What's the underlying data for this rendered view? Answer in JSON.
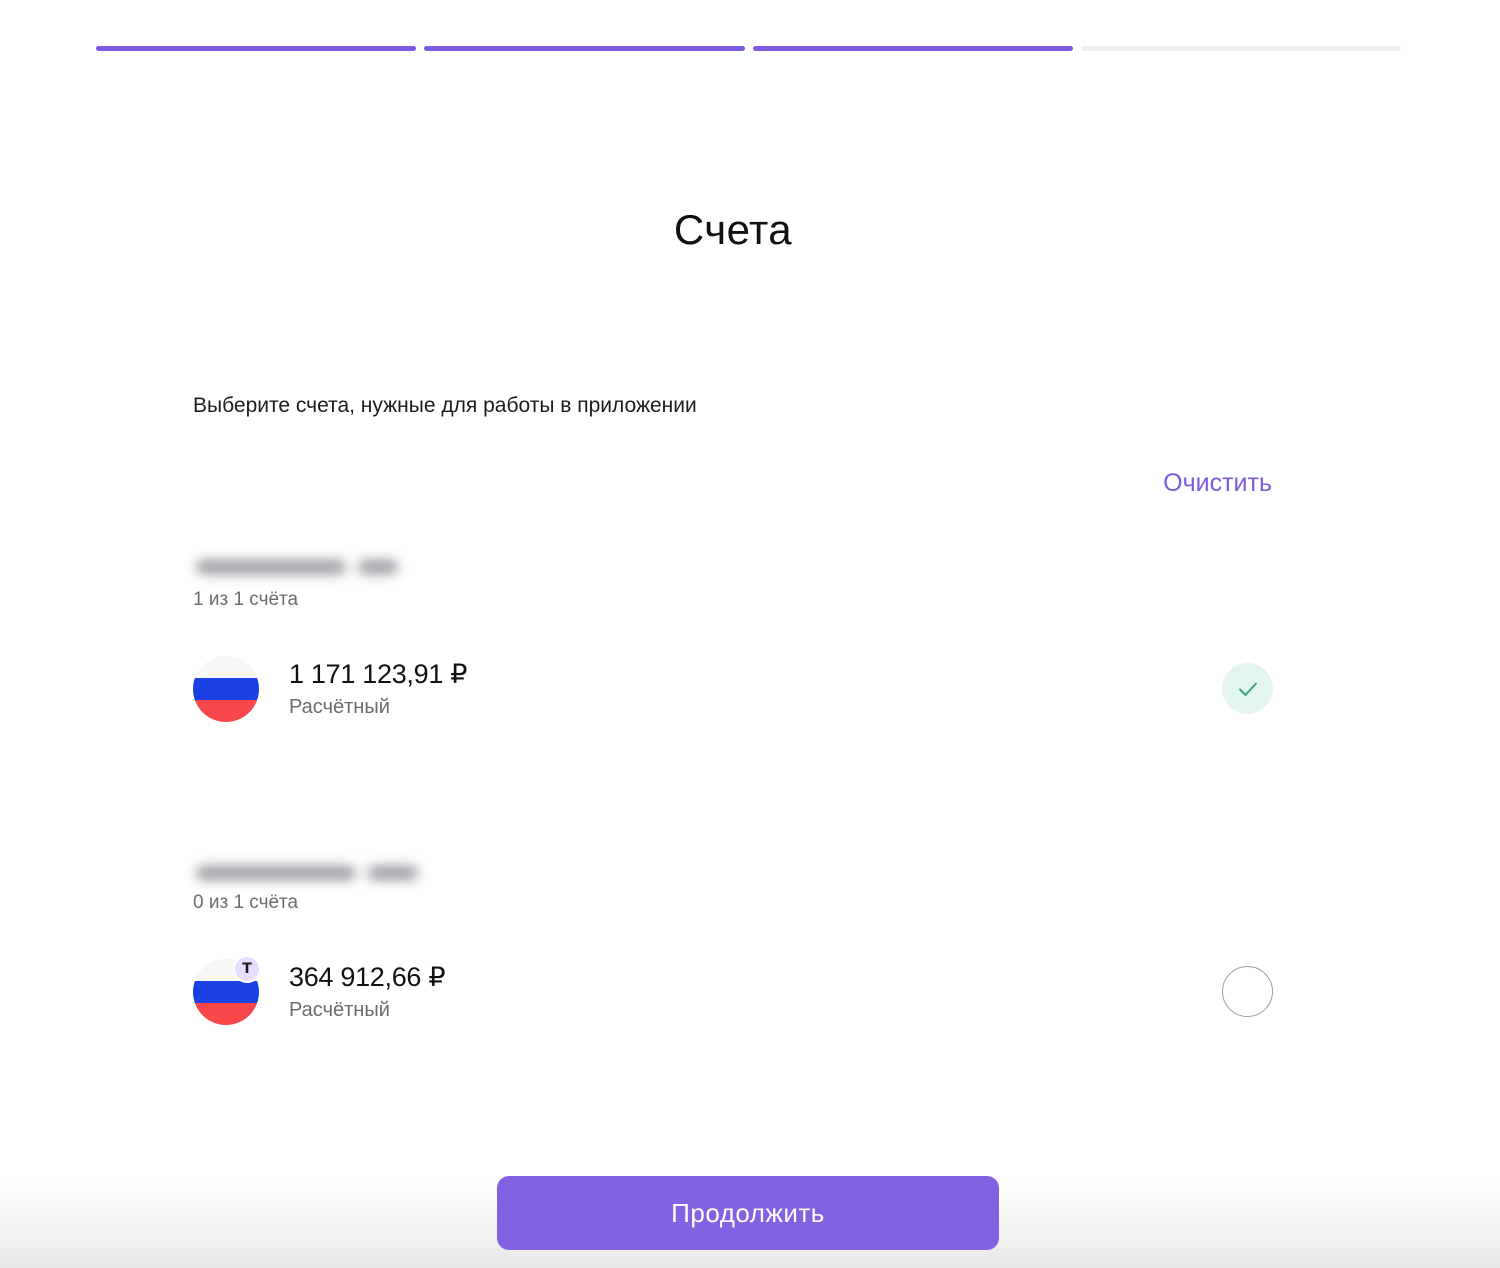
{
  "progress": {
    "total_steps": 4,
    "completed_steps": 3
  },
  "page": {
    "title": "Счета",
    "subtitle": "Выберите счета, нужные для работы в приложении",
    "clear_label": "Очистить"
  },
  "groups": [
    {
      "count_text": "1 из 1 счёта",
      "account": {
        "amount": "1 171 123,91 ₽",
        "type": "Расчётный",
        "selected": true,
        "bank_badge": ""
      }
    },
    {
      "count_text": "0 из 1 счёта",
      "account": {
        "amount": "364 912,66 ₽",
        "type": "Расчётный",
        "selected": false,
        "bank_badge": "T"
      }
    }
  ],
  "footer": {
    "continue_label": "Продолжить"
  },
  "colors": {
    "accent": "#7c5ae2",
    "button": "#8362e2",
    "selected_bg": "#e2f6ef",
    "check": "#3aa57d"
  }
}
